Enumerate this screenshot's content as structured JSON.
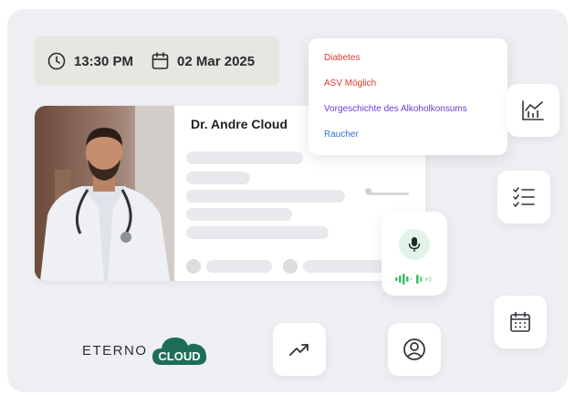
{
  "datetime": {
    "time": "13:30 PM",
    "date": "02 Mar 2025"
  },
  "profile": {
    "doctor_name": "Dr. Andre Cloud"
  },
  "tags": [
    {
      "label": "Diabetes",
      "color": "#e0392f"
    },
    {
      "label": "ASV Möglich",
      "color": "#e0392f"
    },
    {
      "label": "Vorgeschichte des Alkoholkonsums",
      "color": "#6a3fd6"
    },
    {
      "label": "Raucher",
      "color": "#2f72d6"
    }
  ],
  "icons": {
    "chart": "bar-chart-icon",
    "checklist": "checklist-icon",
    "calendar": "calendar-icon",
    "trend": "trending-up-icon",
    "user": "user-circle-icon",
    "mic": "microphone-icon"
  },
  "brand": {
    "name_part1": "ETERNO",
    "name_part2": "CLOUD",
    "cloud_color": "#1d6e57"
  },
  "colors": {
    "accent_green": "#3fbf6a",
    "panel_bg": "#eeeff3"
  }
}
